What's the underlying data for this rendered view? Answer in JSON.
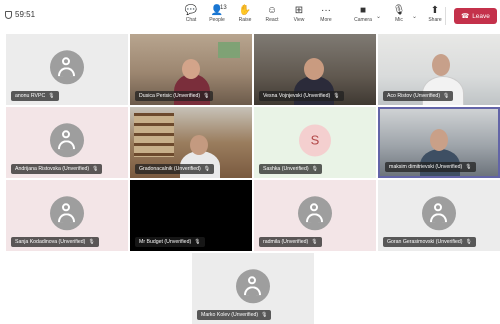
{
  "meeting": {
    "timer": "59:51"
  },
  "toolbar": {
    "chat": "Chat",
    "people": "People",
    "people_count": "13",
    "raise": "Raise",
    "react": "React",
    "view": "View",
    "more": "More",
    "camera": "Camera",
    "mic": "Mic",
    "share": "Share",
    "leave": "Leave"
  },
  "participants": [
    {
      "name": "anonu RVPC",
      "type": "avatar"
    },
    {
      "name": "Dusica Perisic (Unverified)",
      "type": "video"
    },
    {
      "name": "Vesna Vojnjevski (Unverified)",
      "type": "video"
    },
    {
      "name": "Aco Ristov (Unverified)",
      "type": "video"
    },
    {
      "name": "Andrijana Ristovska (Unverified)",
      "type": "avatar"
    },
    {
      "name": "Gradonacalnik (Unverified)",
      "type": "video"
    },
    {
      "name": "Sashka (Unverified)",
      "type": "initial",
      "initial": "S"
    },
    {
      "name": "maksim dimitrievski (Unverified)",
      "type": "video",
      "speaking": true
    },
    {
      "name": "Sanja Kodadinova (Unverified)",
      "type": "avatar"
    },
    {
      "name": "Mr Budget (Unverified)",
      "type": "black"
    },
    {
      "name": "radmila (Unverified)",
      "type": "avatar"
    },
    {
      "name": "Goran Gerasimovski (Unverified)",
      "type": "avatar"
    },
    {
      "name": "Marko Kolev (Unverified)",
      "type": "avatar"
    }
  ],
  "colors": {
    "leave": "#c4314b",
    "speaking_border": "#6264a7",
    "avatar": "#9e9e9e"
  }
}
